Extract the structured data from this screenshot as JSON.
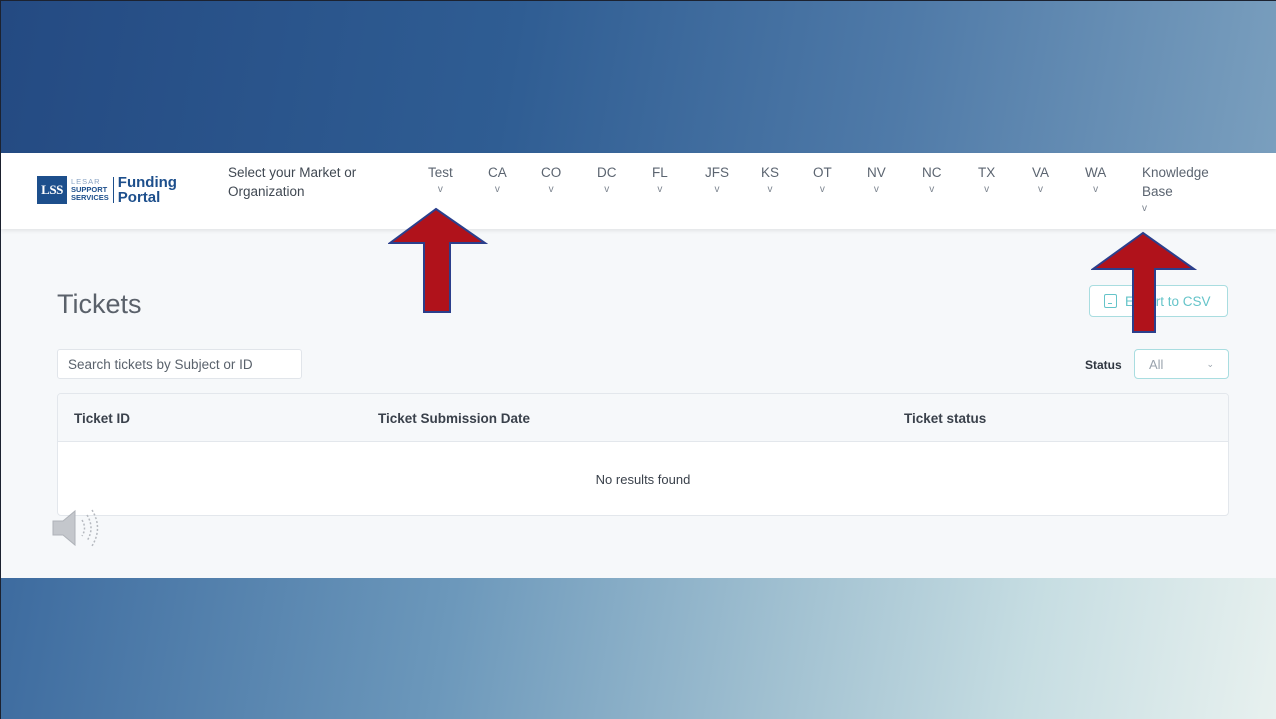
{
  "brand": {
    "badge": "LSS",
    "line1": "LESAR",
    "line2": "SUPPORT",
    "line3": "SERVICES",
    "product1": "Funding",
    "product2": "Portal"
  },
  "nav": {
    "select_label": "Select your Market or Organization",
    "chevron": "v",
    "items": [
      {
        "label": "Test"
      },
      {
        "label": "CA"
      },
      {
        "label": "CO"
      },
      {
        "label": "DC"
      },
      {
        "label": "FL"
      },
      {
        "label": "JFS"
      },
      {
        "label": "KS"
      },
      {
        "label": "OT"
      },
      {
        "label": "NV"
      },
      {
        "label": "NC"
      },
      {
        "label": "TX"
      },
      {
        "label": "VA"
      },
      {
        "label": "WA"
      }
    ],
    "knowledge_base_1": "Knowledge",
    "knowledge_base_2": "Base"
  },
  "page": {
    "title": "Tickets",
    "export_label": "Export to CSV",
    "search_placeholder": "Search tickets by Subject or ID",
    "status_label": "Status",
    "status_value": "All"
  },
  "table": {
    "columns": [
      "Ticket ID",
      "Ticket Submission Date",
      "Ticket status"
    ],
    "empty_text": "No results found"
  },
  "colors": {
    "brand_blue": "#1d4f8c",
    "accent_teal": "#65c4c9",
    "arrow_red": "#b0121b",
    "arrow_outline": "#2b3f8c"
  }
}
